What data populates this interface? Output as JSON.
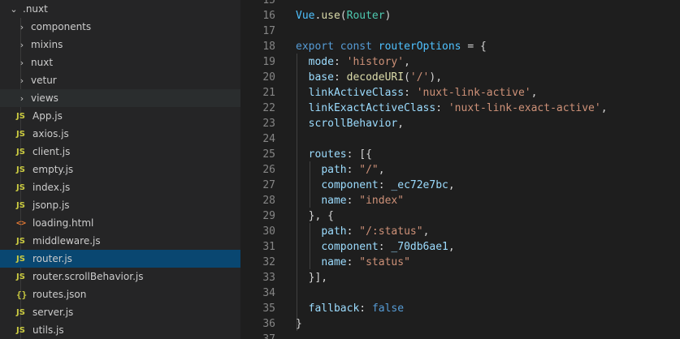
{
  "explorer": {
    "root": {
      "label": ".nuxt",
      "chevron": "chevron-down"
    },
    "folders": [
      {
        "label": "components"
      },
      {
        "label": "mixins"
      },
      {
        "label": "nuxt"
      },
      {
        "label": "vetur"
      },
      {
        "label": "views"
      }
    ],
    "files": [
      {
        "label": "App.js",
        "icon": "JS"
      },
      {
        "label": "axios.js",
        "icon": "JS"
      },
      {
        "label": "client.js",
        "icon": "JS"
      },
      {
        "label": "empty.js",
        "icon": "JS"
      },
      {
        "label": "index.js",
        "icon": "JS"
      },
      {
        "label": "jsonp.js",
        "icon": "JS"
      },
      {
        "label": "loading.html",
        "icon": "<>"
      },
      {
        "label": "middleware.js",
        "icon": "JS"
      },
      {
        "label": "router.js",
        "icon": "JS",
        "selected": true
      },
      {
        "label": "router.scrollBehavior.js",
        "icon": "JS"
      },
      {
        "label": "routes.json",
        "icon": "{}"
      },
      {
        "label": "server.js",
        "icon": "JS"
      },
      {
        "label": "utils.js",
        "icon": "JS"
      }
    ],
    "chevron_right": "›",
    "chevron_down": "⌄"
  },
  "editor": {
    "lines": [
      {
        "n": "15",
        "tokens": []
      },
      {
        "n": "16",
        "tokens": [
          [
            "var",
            "Vue"
          ],
          [
            "punc",
            "."
          ],
          [
            "fn",
            "use"
          ],
          [
            "punc",
            "("
          ],
          [
            "type",
            "Router"
          ],
          [
            "punc",
            ")"
          ]
        ]
      },
      {
        "n": "17",
        "tokens": []
      },
      {
        "n": "18",
        "tokens": [
          [
            "kw",
            "export"
          ],
          [
            "punc",
            " "
          ],
          [
            "kw",
            "const"
          ],
          [
            "punc",
            " "
          ],
          [
            "var",
            "routerOptions"
          ],
          [
            "punc",
            " = {"
          ]
        ]
      },
      {
        "n": "19",
        "tokens": [
          [
            "punc",
            "  "
          ],
          [
            "prop",
            "mode"
          ],
          [
            "punc",
            ": "
          ],
          [
            "str",
            "'history'"
          ],
          [
            "punc",
            ","
          ]
        ]
      },
      {
        "n": "20",
        "tokens": [
          [
            "punc",
            "  "
          ],
          [
            "prop",
            "base"
          ],
          [
            "punc",
            ": "
          ],
          [
            "fn",
            "decodeURI"
          ],
          [
            "punc",
            "("
          ],
          [
            "str",
            "'/'"
          ],
          [
            "punc",
            "),"
          ]
        ]
      },
      {
        "n": "21",
        "tokens": [
          [
            "punc",
            "  "
          ],
          [
            "prop",
            "linkActiveClass"
          ],
          [
            "punc",
            ": "
          ],
          [
            "str",
            "'nuxt-link-active'"
          ],
          [
            "punc",
            ","
          ]
        ]
      },
      {
        "n": "22",
        "tokens": [
          [
            "punc",
            "  "
          ],
          [
            "prop",
            "linkExactActiveClass"
          ],
          [
            "punc",
            ": "
          ],
          [
            "str",
            "'nuxt-link-exact-active'"
          ],
          [
            "punc",
            ","
          ]
        ]
      },
      {
        "n": "23",
        "tokens": [
          [
            "punc",
            "  "
          ],
          [
            "prop",
            "scrollBehavior"
          ],
          [
            "punc",
            ","
          ]
        ]
      },
      {
        "n": "24",
        "tokens": []
      },
      {
        "n": "25",
        "tokens": [
          [
            "punc",
            "  "
          ],
          [
            "prop",
            "routes"
          ],
          [
            "punc",
            ": [{"
          ]
        ]
      },
      {
        "n": "26",
        "tokens": [
          [
            "punc",
            "    "
          ],
          [
            "prop",
            "path"
          ],
          [
            "punc",
            ": "
          ],
          [
            "str",
            "\"/\""
          ],
          [
            "punc",
            ","
          ]
        ]
      },
      {
        "n": "27",
        "tokens": [
          [
            "punc",
            "    "
          ],
          [
            "prop",
            "component"
          ],
          [
            "punc",
            ": "
          ],
          [
            "prop",
            "_ec72e7bc"
          ],
          [
            "punc",
            ","
          ]
        ]
      },
      {
        "n": "28",
        "tokens": [
          [
            "punc",
            "    "
          ],
          [
            "prop",
            "name"
          ],
          [
            "punc",
            ": "
          ],
          [
            "str",
            "\"index\""
          ]
        ]
      },
      {
        "n": "29",
        "tokens": [
          [
            "punc",
            "  }, {"
          ]
        ]
      },
      {
        "n": "30",
        "tokens": [
          [
            "punc",
            "    "
          ],
          [
            "prop",
            "path"
          ],
          [
            "punc",
            ": "
          ],
          [
            "str",
            "\"/:status\""
          ],
          [
            "punc",
            ","
          ]
        ]
      },
      {
        "n": "31",
        "tokens": [
          [
            "punc",
            "    "
          ],
          [
            "prop",
            "component"
          ],
          [
            "punc",
            ": "
          ],
          [
            "prop",
            "_70db6ae1"
          ],
          [
            "punc",
            ","
          ]
        ]
      },
      {
        "n": "32",
        "tokens": [
          [
            "punc",
            "    "
          ],
          [
            "prop",
            "name"
          ],
          [
            "punc",
            ": "
          ],
          [
            "str",
            "\"status\""
          ]
        ]
      },
      {
        "n": "33",
        "tokens": [
          [
            "punc",
            "  }],"
          ]
        ]
      },
      {
        "n": "34",
        "tokens": []
      },
      {
        "n": "35",
        "tokens": [
          [
            "punc",
            "  "
          ],
          [
            "prop",
            "fallback"
          ],
          [
            "punc",
            ": "
          ],
          [
            "kw",
            "false"
          ]
        ]
      },
      {
        "n": "36",
        "tokens": [
          [
            "punc",
            "}"
          ]
        ]
      },
      {
        "n": "37",
        "tokens": []
      }
    ]
  }
}
